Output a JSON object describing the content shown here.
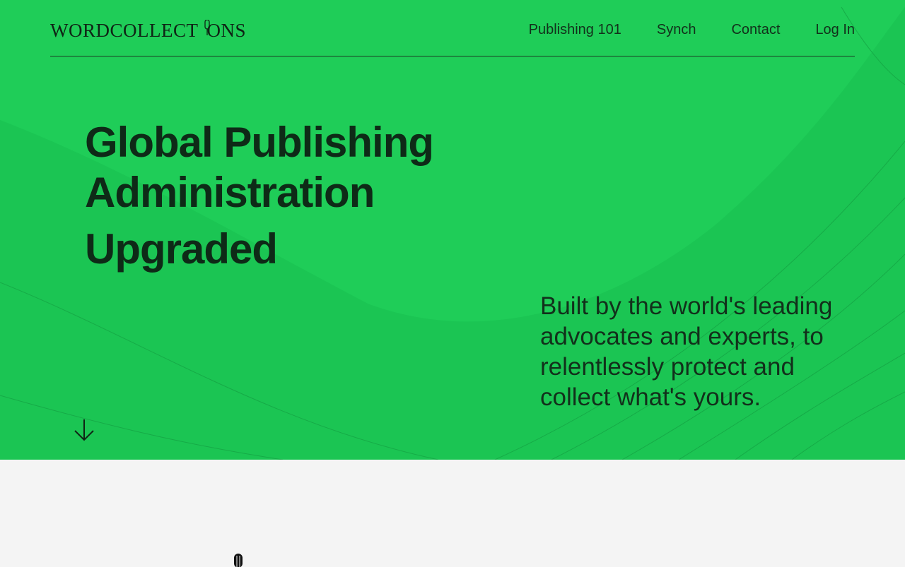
{
  "brand": {
    "logo_text_left": "WORDCOLLECT",
    "logo_text_right": "ONS",
    "logo_icon": "microphone-icon"
  },
  "nav": {
    "items": [
      {
        "label": "Publishing 101"
      },
      {
        "label": "Synch"
      },
      {
        "label": "Contact"
      },
      {
        "label": "Log In"
      }
    ]
  },
  "hero": {
    "headline_line1": "Global Publishing",
    "headline_line2": "Administration",
    "headline_line3": "Upgraded",
    "tagline": "Built by the world's leading advocates and experts, to relentlessly protect and collect what's yours.",
    "scroll_icon": "arrow-down-icon",
    "background_color": "#1dc956"
  }
}
